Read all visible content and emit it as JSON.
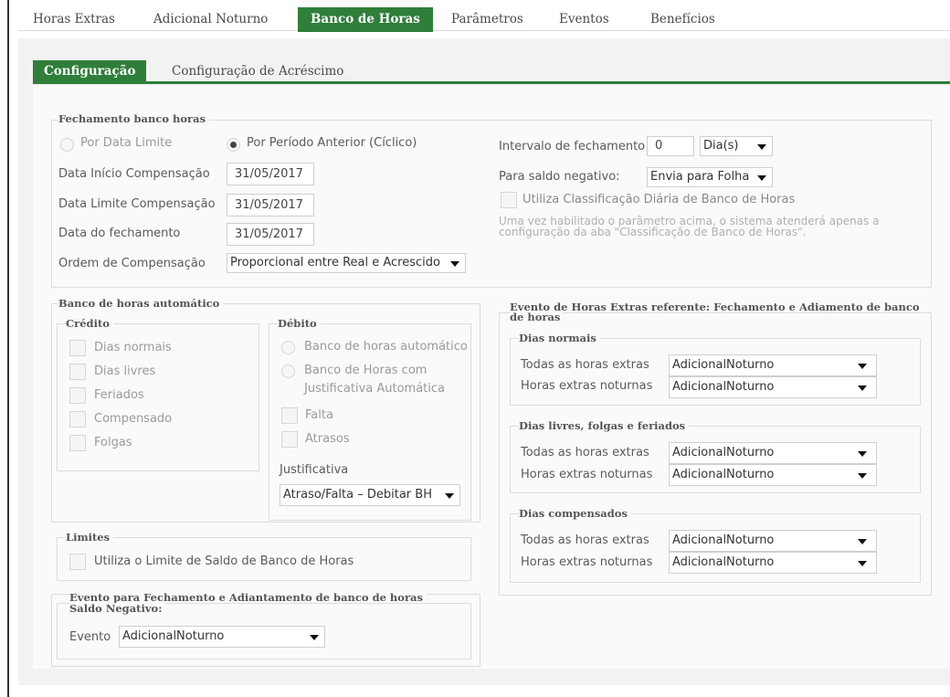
{
  "top_tabs": [
    "Horas Extras",
    "Adicional Noturno",
    "Banco de Horas",
    "Parâmetros",
    "Eventos",
    "Benefícios"
  ],
  "sub_tabs": [
    "Configuração",
    "Configuração de Acréscimo"
  ],
  "fechamento": {
    "legend": "Fechamento banco horas",
    "radio_data_limite": "Por Data Limite",
    "radio_periodo_anterior": "Por Período Anterior (Cíclico)",
    "data_inicio_label": "Data Início Compensação",
    "data_inicio_value": "31/05/2017",
    "data_limite_label": "Data Limite Compensação",
    "data_limite_value": "31/05/2017",
    "data_fechamento_label": "Data do fechamento",
    "data_fechamento_value": "31/05/2017",
    "ordem_label": "Ordem de Compensação",
    "ordem_value": "Proporcional entre Real e Acrescido",
    "intervalo_label": "Intervalo de fechamento",
    "intervalo_value": "0",
    "intervalo_unit": "Dia(s)",
    "saldo_negativo_label": "Para saldo negativo:",
    "saldo_negativo_value": "Envia para Folha",
    "classificacao_label": "Utiliza Classificação Diária de Banco de Horas",
    "hint": "Uma vez habilitado o parâmetro acima, o sistema atenderá apenas a configuração da aba \"Classificação de Banco de Horas\"."
  },
  "banco_auto": {
    "legend": "Banco de horas automático",
    "credito_legend": "Crédito",
    "credito_items": [
      "Dias normais",
      "Dias livres",
      "Feriados",
      "Compensado",
      "Folgas"
    ],
    "debito_legend": "Débito",
    "debito_radio1": "Banco de horas automático",
    "debito_radio2_line1": "Banco de Horas com",
    "debito_radio2_line2": "Justificativa Automática",
    "debito_checks": [
      "Falta",
      "Atrasos"
    ],
    "justificativa_label": "Justificativa",
    "justificativa_value": "Atraso/Falta – Debitar BH"
  },
  "limites": {
    "legend": "Limites",
    "check_label": "Utiliza o Limite de Saldo de Banco de Horas"
  },
  "evento_saldo": {
    "legend_line1": "Evento para Fechamento e Adiantamento de banco de horas",
    "legend_line2": "Saldo Negativo:",
    "evento_label": "Evento",
    "evento_value": "AdicionalNoturno"
  },
  "evento_he": {
    "legend_line1": "Evento de Horas Extras referente: Fechamento e Adiamento de banco",
    "legend_line2": "de horas",
    "groups": [
      {
        "legend": "Dias normais",
        "todas_label": "Todas as horas extras",
        "todas_value": "AdicionalNoturno",
        "noturnas_label": "Horas extras noturnas",
        "noturnas_value": "AdicionalNoturno"
      },
      {
        "legend": "Dias livres, folgas e feriados",
        "todas_label": "Todas as horas extras",
        "todas_value": "AdicionalNoturno",
        "noturnas_label": "Horas extras noturnas",
        "noturnas_value": "AdicionalNoturno"
      },
      {
        "legend": "Dias compensados",
        "todas_label": "Todas as horas extras",
        "todas_value": "AdicionalNoturno",
        "noturnas_label": "Horas extras noturnas",
        "noturnas_value": "AdicionalNoturno"
      }
    ]
  },
  "colors": {
    "accent": "#2f7e3a",
    "panel_bg": "#f2f2f2",
    "content_bg": "#fafafa"
  }
}
